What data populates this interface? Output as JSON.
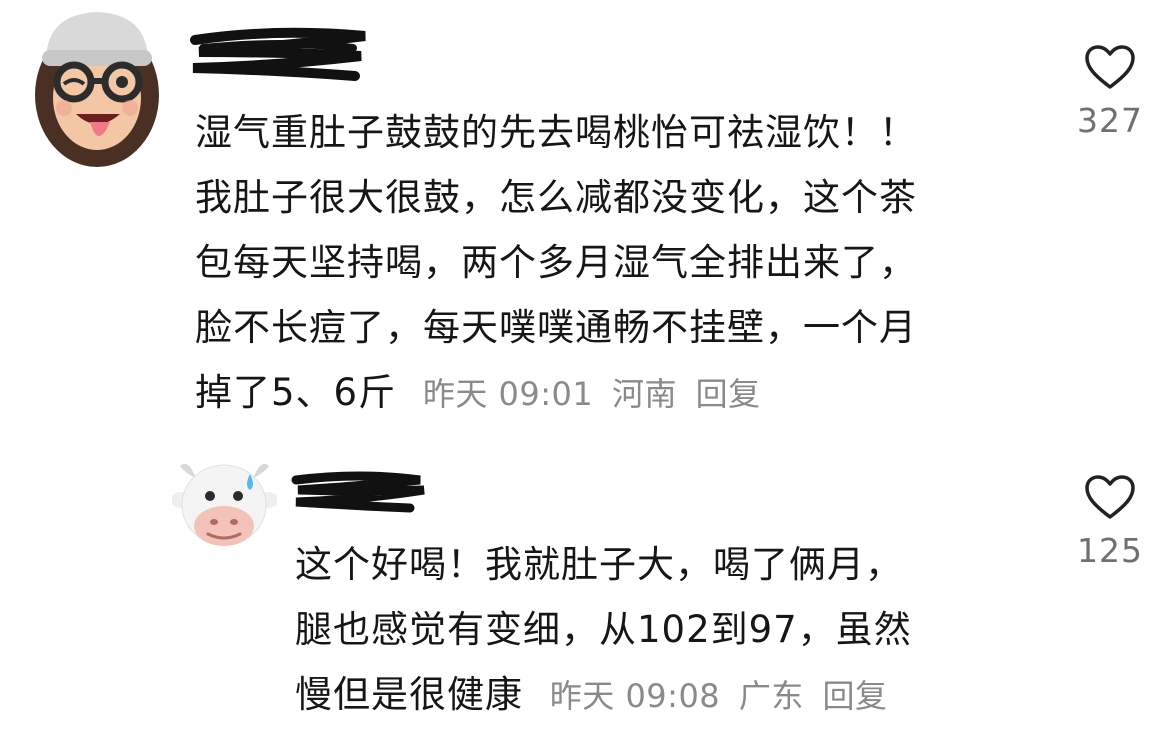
{
  "comments": [
    {
      "avatar_icon": "memoji-woman-glasses-beanie-avatar",
      "username_redacted": true,
      "lines": [
        "湿气重肚子鼓鼓的先去喝桃怡可祛湿饮！！",
        "我肚子很大很鼓，怎么减都没变化，这个茶",
        "包每天坚持喝，两个多月湿气全排出来了，",
        "脸不长痘了，每天噗噗通畅不挂壁，一个月",
        "掉了5、6斤"
      ],
      "time": "昨天 09:01",
      "location": "河南",
      "reply_label": "回复",
      "like_icon": "heart-outline-icon",
      "like_count": "327"
    },
    {
      "avatar_icon": "memoji-cow-sweat-avatar",
      "username_redacted": true,
      "lines": [
        "这个好喝！我就肚子大，喝了俩月，",
        "腿也感觉有变细，从102到97，虽然",
        "慢但是很健康"
      ],
      "time": "昨天 09:08",
      "location": "广东",
      "reply_label": "回复",
      "like_icon": "heart-outline-icon",
      "like_count": "125"
    }
  ]
}
